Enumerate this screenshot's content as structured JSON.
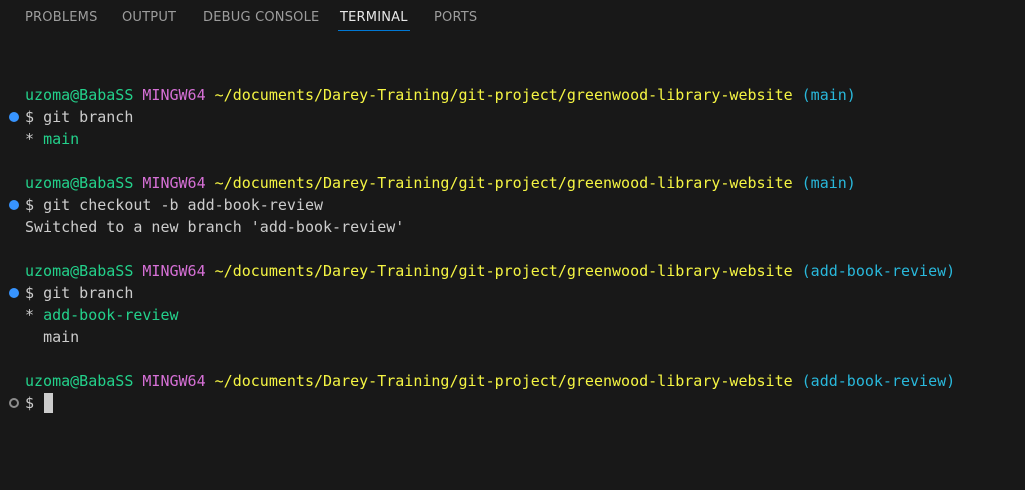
{
  "panel_tabs": [
    {
      "label": "PROBLEMS",
      "active": false
    },
    {
      "label": "OUTPUT",
      "active": false
    },
    {
      "label": "DEBUG CONSOLE",
      "active": false
    },
    {
      "label": "TERMINAL",
      "active": true
    },
    {
      "label": "PORTS",
      "active": false
    }
  ],
  "terminal": {
    "user_host": "uzoma@BabaSS",
    "shell": "MINGW64",
    "cwd": "~/documents/Darey-Training/git-project/greenwood-library-website",
    "prompt_symbol": "$",
    "blocks": [
      {
        "branch": "(main)",
        "command": "git branch",
        "status": "done",
        "output": [
          {
            "marker": "* ",
            "text": "main",
            "highlight": true
          }
        ]
      },
      {
        "branch": "(main)",
        "command": "git checkout -b add-book-review",
        "status": "done",
        "output": [
          {
            "marker": "",
            "text": "Switched to a new branch 'add-book-review'",
            "highlight": false
          }
        ]
      },
      {
        "branch": "(add-book-review)",
        "command": "git branch",
        "status": "done",
        "output": [
          {
            "marker": "* ",
            "text": "add-book-review",
            "highlight": true
          },
          {
            "marker": "  ",
            "text": "main",
            "highlight": false
          }
        ]
      },
      {
        "branch": "(add-book-review)",
        "command": "",
        "status": "pending",
        "output": []
      }
    ]
  },
  "colors": {
    "background": "#181818",
    "user": "#23d18b",
    "shell": "#d670d6",
    "path": "#f5f543",
    "branch": "#29b8db",
    "active_tab_underline": "#0078d4",
    "decoration_success": "#3794ff"
  }
}
